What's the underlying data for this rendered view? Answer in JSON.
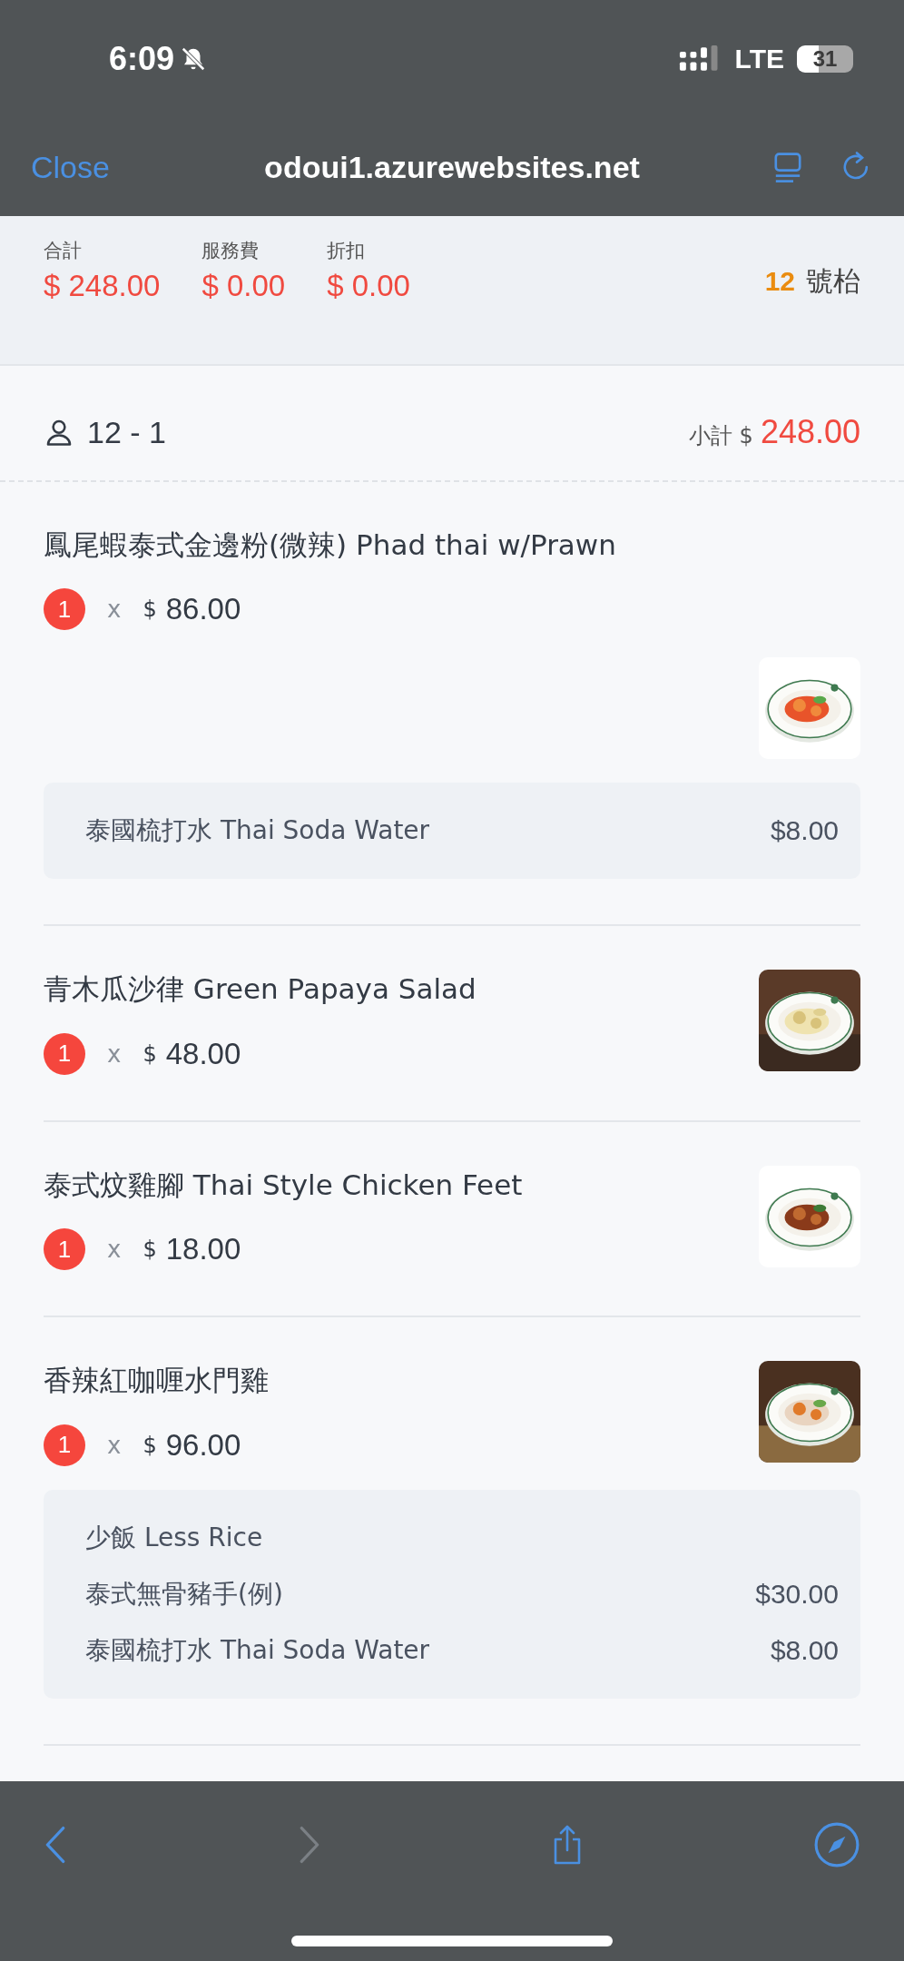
{
  "status_bar": {
    "time": "6:09",
    "network": "LTE",
    "battery": "31"
  },
  "browser": {
    "close": "Close",
    "url": "odoui1.azurewebsites.net"
  },
  "summary": {
    "fields": [
      {
        "label": "合計",
        "value": "$ 248.00"
      },
      {
        "label": "服務費",
        "value": "$ 0.00"
      },
      {
        "label": "折扣",
        "value": "$ 0.00"
      }
    ],
    "table_number": "12",
    "table_suffix": "號枱"
  },
  "order": {
    "guest": "12 - 1",
    "subtotal_label": "小計 $",
    "subtotal": "248.00"
  },
  "items": [
    {
      "name": "鳳尾蝦泰式金邊粉(微辣) Phad thai w/Prawn",
      "quantity": "1",
      "multiplier": "x",
      "currency": "$",
      "price": "86.00",
      "picture": {
        "kind": "picture"
      },
      "addons": [
        {
          "name": "泰國梳打水 Thai Soda Water",
          "price": "$8.00"
        }
      ]
    },
    {
      "name": "青木瓜沙律 Green Papaya Salad",
      "quantity": "1",
      "multiplier": "x",
      "currency": "$",
      "price": "48.00",
      "picture": {
        "kind": "picture"
      }
    },
    {
      "name": "泰式炆雞腳 Thai Style Chicken Feet",
      "quantity": "1",
      "multiplier": "x",
      "currency": "$",
      "price": "18.00",
      "picture": {
        "kind": "picture"
      }
    },
    {
      "name": "香辣紅咖喱水門雞",
      "quantity": "1",
      "multiplier": "x",
      "currency": "$",
      "price": "96.00",
      "picture": {
        "kind": "picture"
      },
      "addons": [
        {
          "name": "少飯 Less Rice"
        },
        {
          "name": "泰式無骨豬手(例)",
          "price": "$30.00"
        },
        {
          "name": "泰國梳打水 Thai Soda Water",
          "price": "$8.00"
        }
      ]
    }
  ],
  "toolbar": {
    "back": {
      "disabled": false
    },
    "forward": {
      "disabled": true
    }
  }
}
